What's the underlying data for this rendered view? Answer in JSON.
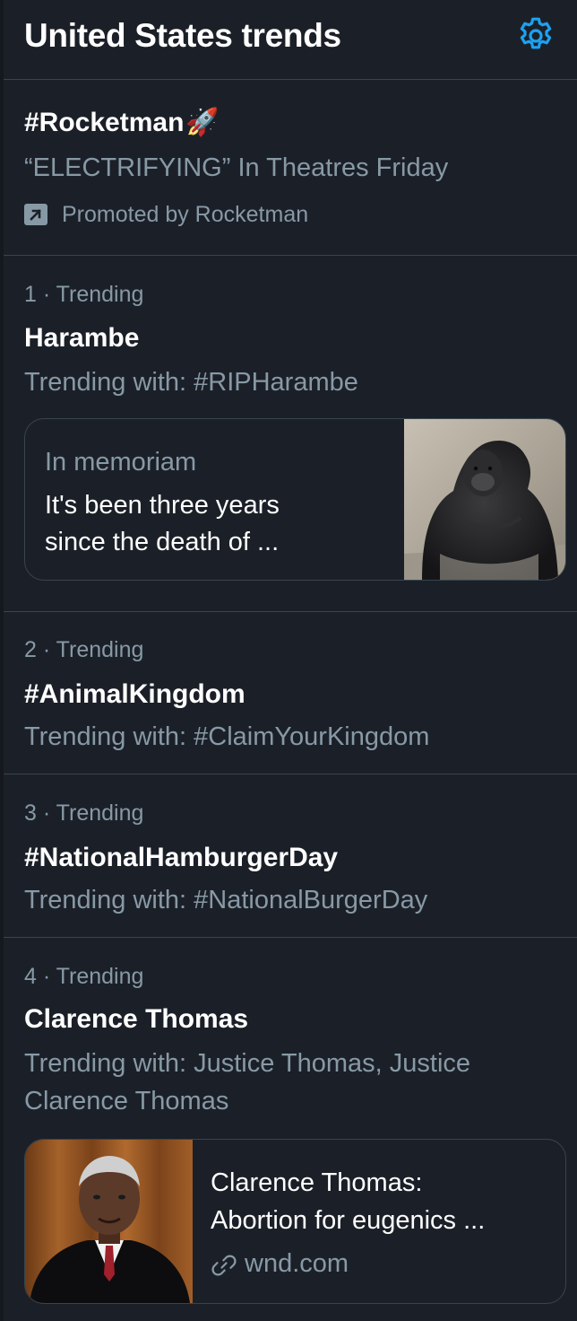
{
  "header": {
    "title": "United States trends"
  },
  "promoted": {
    "hashtag": "#Rocketman",
    "emoji": "🚀",
    "tagline": "“ELECTRIFYING” In Theatres Friday",
    "label": "Promoted by Rocketman"
  },
  "trends": [
    {
      "meta": "1 · Trending",
      "name": "Harambe",
      "with": "Trending with: #RIPHarambe",
      "card": {
        "eyebrow": "In memoriam",
        "line1": "It's been three years",
        "line2": "since the death of ..."
      }
    },
    {
      "meta": "2 · Trending",
      "name": "#AnimalKingdom",
      "with": "Trending with: #ClaimYourKingdom"
    },
    {
      "meta": "3 · Trending",
      "name": "#NationalHamburgerDay",
      "with": "Trending with: #NationalBurgerDay"
    },
    {
      "meta": "4 · Trending",
      "name": "Clarence Thomas",
      "with_line1": "Trending with: Justice Thomas, Justice",
      "with_line2": "Clarence Thomas",
      "card": {
        "line1": "Clarence Thomas:",
        "line2": "Abortion for eugenics ...",
        "domain": "wnd.com"
      }
    }
  ],
  "icons": {
    "settings": "gear-icon",
    "promoted": "promoted-arrow-icon",
    "link": "link-icon"
  },
  "colors": {
    "background": "#1b2028",
    "accent": "#1da1f2",
    "muted_text": "#8899a6",
    "divider": "#38444d"
  }
}
